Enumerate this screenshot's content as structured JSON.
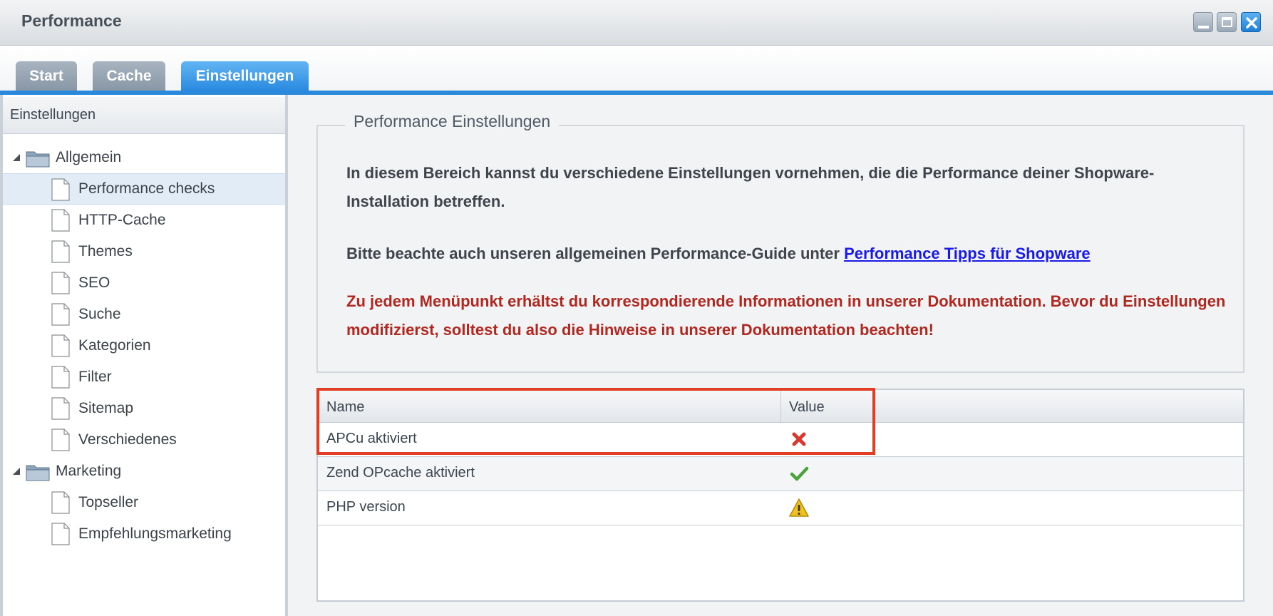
{
  "window": {
    "title": "Performance"
  },
  "tabs": [
    {
      "label": "Start",
      "active": false
    },
    {
      "label": "Cache",
      "active": false
    },
    {
      "label": "Einstellungen",
      "active": true
    }
  ],
  "sidebar": {
    "header": "Einstellungen",
    "groups": [
      {
        "label": "Allgemein",
        "items": [
          "Performance checks",
          "HTTP-Cache",
          "Themes",
          "SEO",
          "Suche",
          "Kategorien",
          "Filter",
          "Sitemap",
          "Verschiedenes"
        ]
      },
      {
        "label": "Marketing",
        "items": [
          "Topseller",
          "Empfehlungsmarketing"
        ]
      }
    ],
    "selected": "Performance checks"
  },
  "main": {
    "legend": "Performance Einstellungen",
    "intro": "In diesem Bereich kannst du verschiedene Einstellungen vornehmen, die die Performance deiner Shopware-Installation betreffen.",
    "guide_text": "Bitte beachte auch unseren allgemeinen Performance-Guide unter ",
    "guide_link": "Performance Tipps für Shopware",
    "warning": "Zu jedem Menüpunkt erhältst du korrespondierende Informationen in unserer Dokumentation. Bevor du Einstellungen modifizierst, solltest du also die Hinweise in unserer Dokumentation beachten!",
    "grid": {
      "columns": [
        "Name",
        "Value"
      ],
      "rows": [
        {
          "name": "APCu aktiviert",
          "status": "error-icon"
        },
        {
          "name": "Zend OPcache aktiviert",
          "status": "check-icon"
        },
        {
          "name": "PHP version",
          "status": "warning-icon"
        }
      ]
    }
  },
  "colors": {
    "accent": "#2b89dc",
    "warning_text": "#b0281f",
    "highlight": "#e03f26"
  }
}
